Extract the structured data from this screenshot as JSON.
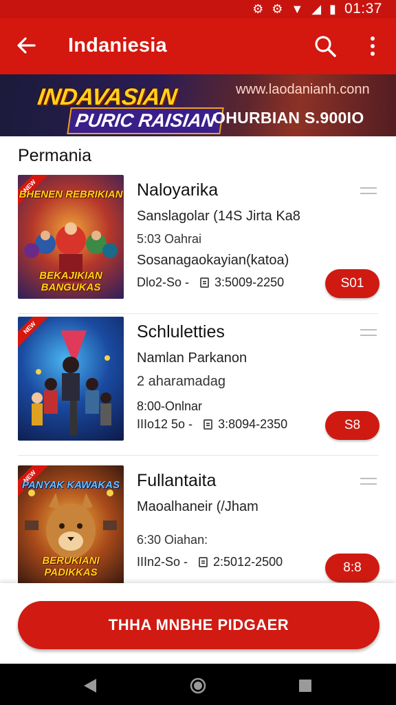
{
  "status_bar": {
    "time": "01:37"
  },
  "app_bar": {
    "title": "Indaniesia"
  },
  "banner": {
    "logo_line1": "INDAVASIAN",
    "logo_line2": "PURIC RAISIAN",
    "url": "www.laodanianh.conn",
    "promo": "OHURBIAN S.900IO"
  },
  "section": {
    "title": "Permania"
  },
  "items": [
    {
      "name": "Naloyarika",
      "line1": "Sanslagolar (14S Jirta Ka8",
      "line2": "5:03 Oahrai",
      "line3": "Sosanagaokayian(katoa)",
      "meta_left": "Dlo2-So -",
      "meta_right": "3:5009-2250",
      "price": "S01",
      "art_top": "BHENEN REBRIKIAN",
      "art_bottom": "BEKAJIKIAN BANGUKAS"
    },
    {
      "name": "Schluletties",
      "line1": "Namlan Parkanon",
      "line2": "2 aharamadag",
      "line3": "8:00-Onlnar",
      "meta_left": "IIIo12 5o -",
      "meta_right": "3:8094-2350",
      "price": "S8",
      "art_top": "",
      "art_bottom": ""
    },
    {
      "name": "Fullantaita",
      "line1": "Maoalhaneir (/Jham",
      "line2": "6:30 Oiahan:",
      "line3": "",
      "meta_left": "IIIn2-So -",
      "meta_right": "2:5012-2500",
      "price": "8:8",
      "art_top": "PANYAK KAWAKAS",
      "art_bottom": "BERUKIANI PADIKKAS"
    }
  ],
  "cta": {
    "label": "THHA MNBHE PIDGAER"
  },
  "colors": {
    "primary": "#d4170f",
    "price": "#cf1a12"
  }
}
